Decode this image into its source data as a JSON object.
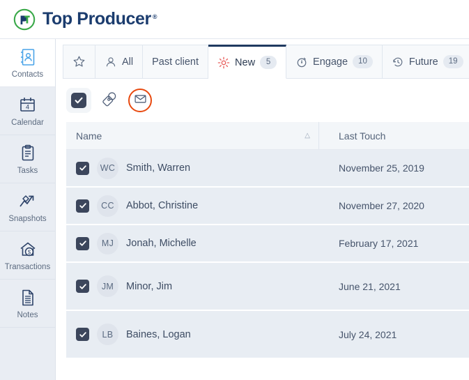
{
  "brand": {
    "name": "Top Producer",
    "registered": "®",
    "logo_icon": "tp-monogram-icon",
    "ring_color": "#3aa949",
    "text_color": "#1b3c6e",
    "accent_color": "#e8490f"
  },
  "sidebar": {
    "items": [
      {
        "label": "Contacts",
        "icon": "contacts-icon",
        "active": true,
        "badge": ""
      },
      {
        "label": "Calendar",
        "icon": "calendar-icon",
        "active": false,
        "badge": "4"
      },
      {
        "label": "Tasks",
        "icon": "tasks-icon",
        "active": false,
        "badge": ""
      },
      {
        "label": "Snapshots",
        "icon": "snapshots-icon",
        "active": false,
        "badge": ""
      },
      {
        "label": "Transactions",
        "icon": "transactions-icon",
        "active": false,
        "badge": ""
      },
      {
        "label": "Notes",
        "icon": "notes-icon",
        "active": false,
        "badge": ""
      }
    ]
  },
  "tabs": [
    {
      "label": "",
      "icon": "star-icon",
      "badge": "",
      "active": false
    },
    {
      "label": "All",
      "icon": "person-icon",
      "badge": "",
      "active": false
    },
    {
      "label": "Past client",
      "icon": "",
      "badge": "",
      "active": false
    },
    {
      "label": "New",
      "icon": "sunburst-icon",
      "badge": "5",
      "active": true
    },
    {
      "label": "Engage",
      "icon": "stopwatch-icon",
      "badge": "10",
      "active": false
    },
    {
      "label": "Future",
      "icon": "clock-back-icon",
      "badge": "19",
      "active": false
    }
  ],
  "toolbar": {
    "select_all": {
      "name": "select-all-checkbox",
      "checked": true
    },
    "tag": {
      "name": "tag-icon",
      "label": ""
    },
    "email": {
      "name": "envelope-icon",
      "label": "",
      "highlighted": true
    }
  },
  "table": {
    "columns": [
      {
        "key": "name",
        "label": "Name",
        "sort": "asc"
      },
      {
        "key": "last_touch",
        "label": "Last Touch",
        "sort": ""
      }
    ],
    "sort_glyph": "△",
    "rows": [
      {
        "checked": true,
        "initials": "WC",
        "name": "Smith, Warren",
        "last_touch": "November 25, 2019"
      },
      {
        "checked": true,
        "initials": "CC",
        "name": "Abbot, Christine",
        "last_touch": "November 27, 2020"
      },
      {
        "checked": true,
        "initials": "MJ",
        "name": "Jonah, Michelle",
        "last_touch": "February 17, 2021"
      },
      {
        "checked": true,
        "initials": "JM",
        "name": "Minor, Jim",
        "last_touch": "June 21, 2021"
      },
      {
        "checked": true,
        "initials": "LB",
        "name": "Baines, Logan",
        "last_touch": "July 24, 2021"
      }
    ]
  }
}
